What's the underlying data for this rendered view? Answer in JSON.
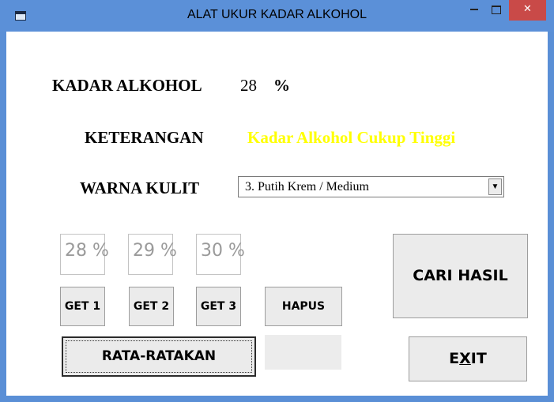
{
  "window": {
    "title": "ALAT UKUR KADAR ALKOHOL",
    "close_glyph": "✕"
  },
  "kadar": {
    "label": "KADAR ALKOHOL",
    "value": "28",
    "unit": "%"
  },
  "keterangan": {
    "label": "KETERANGAN",
    "value": "Kadar Alkohol Cukup Tinggi",
    "color": "#ffff00"
  },
  "warna_kulit": {
    "label": "WARNA KULIT",
    "selected": "3. Putih Krem / Medium"
  },
  "readings": [
    {
      "value": "28 %"
    },
    {
      "value": "29 %"
    },
    {
      "value": "30 %"
    }
  ],
  "buttons": {
    "get1": "GET 1",
    "get2": "GET 2",
    "get3": "GET 3",
    "hapus": "HAPUS",
    "rata": "RATA-RATAKAN",
    "cari": "CARI HASIL",
    "exit_before": "E",
    "exit_underlined": "X",
    "exit_after": "IT"
  },
  "average_readout": ""
}
